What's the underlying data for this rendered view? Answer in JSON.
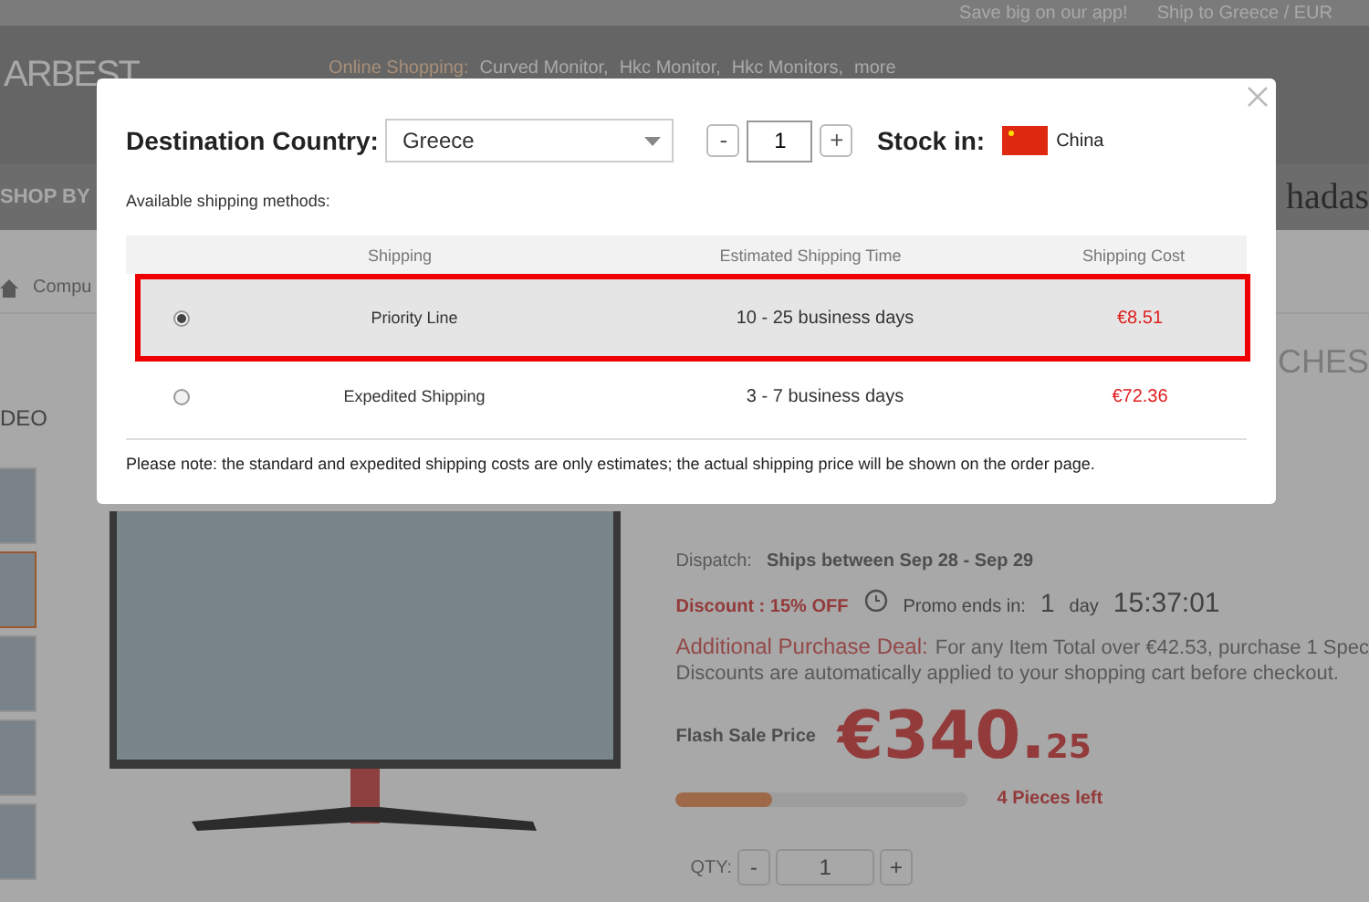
{
  "top_bar": {
    "app_link": "Save big on our app!",
    "ship_to": "Ship to Greece / EUR"
  },
  "header": {
    "logo": "ARBEST",
    "suggestions_label": "Online Shopping:",
    "suggestions": [
      "Curved Monitor,",
      "Hkc Monitor,",
      "Hkc Monitors,",
      "more"
    ]
  },
  "nav": {
    "menu": "SHOP BY",
    "right_text": "hadas"
  },
  "breadcrumb": {
    "item": "Compu"
  },
  "gallery": {
    "video_label": "DEO",
    "thumbnails": [
      {
        "selected": false
      },
      {
        "selected": true
      },
      {
        "selected": false
      },
      {
        "selected": false
      },
      {
        "selected": false
      }
    ]
  },
  "product": {
    "title_fragment": "CHES",
    "dispatch_label": "Dispatch:",
    "dispatch_value": "Ships between Sep 28 - Sep 29",
    "discount": "Discount : 15% OFF",
    "promo_label": "Promo ends in:",
    "promo_days": "1",
    "promo_day_unit": "day",
    "promo_time": "15:37:01",
    "deal_label": "Additional Purchase Deal:",
    "deal_text": "For any Item Total over €42.53, purchase 1 Spec",
    "deal_note": "Discounts are automatically applied to your shopping cart before checkout.",
    "price_label": "Flash Sale Price",
    "price_main": "€340.",
    "price_cents": "25",
    "stock": {
      "level": 0.33,
      "text": "4 Pieces left"
    },
    "qty_label": "QTY:",
    "qty_minus": "-",
    "qty_value": "1",
    "qty_plus": "+"
  },
  "dialog": {
    "destination_label": "Destination Country:",
    "country": "Greece",
    "qty_minus": "-",
    "qty": "1",
    "qty_plus": "+",
    "stock_label": "Stock in:",
    "stock_country": "China",
    "methods_label": "Available shipping methods:",
    "columns": [
      "Shipping",
      "Estimated Shipping Time",
      "Shipping Cost"
    ],
    "methods": [
      {
        "name": "Priority Line",
        "time": "10 - 25 business days",
        "cost": "€8.51",
        "selected": true
      },
      {
        "name": "Expedited Shipping",
        "time": "3 - 7 business days",
        "cost": "€72.36",
        "selected": false
      }
    ],
    "note": "Please note: the standard and expedited shipping costs are only estimates; the actual shipping price will be shown on the order page."
  }
}
